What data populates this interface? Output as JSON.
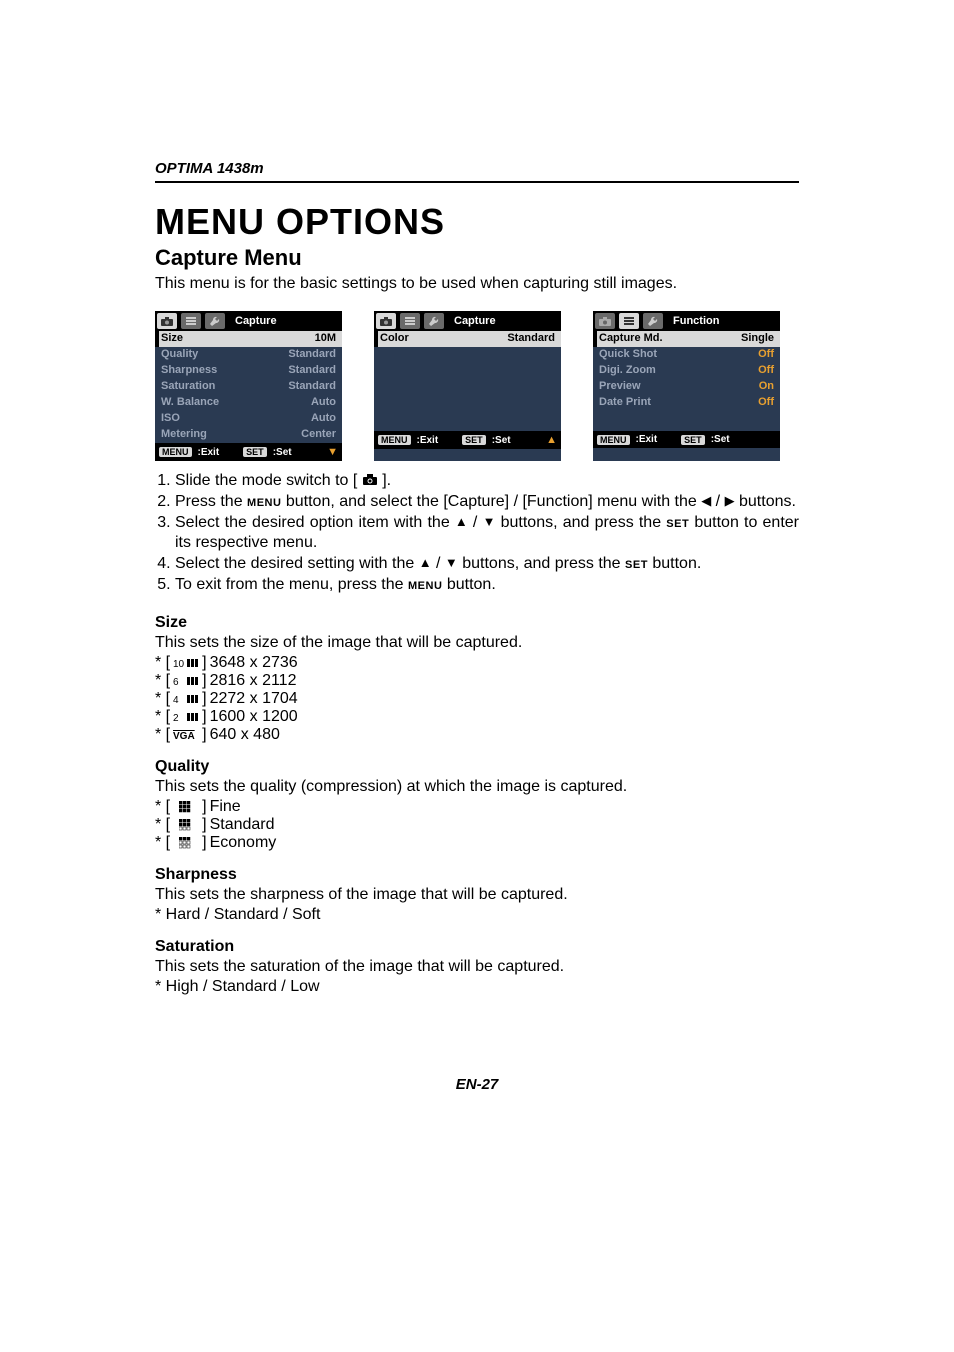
{
  "header": {
    "model": "OPTIMA 1438m"
  },
  "title": "MENU OPTIONS",
  "subtitle": "Capture Menu",
  "intro": "This menu is for the basic settings to be used when capturing still images.",
  "screens": {
    "s1": {
      "tabTitle": "Capture",
      "rows": [
        {
          "label": "Size",
          "value": "10M",
          "sel": true
        },
        {
          "label": "Quality",
          "value": "Standard"
        },
        {
          "label": "Sharpness",
          "value": "Standard"
        },
        {
          "label": "Saturation",
          "value": "Standard"
        },
        {
          "label": "W. Balance",
          "value": "Auto"
        },
        {
          "label": "ISO",
          "value": "Auto"
        },
        {
          "label": "Metering",
          "value": "Center"
        }
      ],
      "arrow": "▼"
    },
    "s2": {
      "tabTitle": "Capture",
      "rows": [
        {
          "label": "Color",
          "value": "Standard",
          "sel": true
        }
      ],
      "arrow": "▲"
    },
    "s3": {
      "tabTitle": "Function",
      "rows": [
        {
          "label": "Capture Md.",
          "value": "Single",
          "sel": true
        },
        {
          "label": "Quick Shot",
          "value": "Off",
          "orange": true
        },
        {
          "label": "Digi. Zoom",
          "value": "Off",
          "orange": true
        },
        {
          "label": "Preview",
          "value": "On",
          "orange": true
        },
        {
          "label": "Date Print",
          "value": "Off",
          "orange": true
        }
      ],
      "arrow": ""
    },
    "bottom": {
      "menuLabel": "MENU",
      "exitLabel": ":Exit",
      "setLabel": "SET",
      "setSuffix": ":Set"
    }
  },
  "steps": [
    "Slide the mode switch to [ 📷 ].",
    "Press the MENU button, and select the [Capture] / [Function] menu with the ◀ / ▶ buttons.",
    "Select the desired option item with the ▲ / ▼ buttons, and press the SET button to enter its respective menu.",
    "Select the desired setting with the ▲ / ▼ buttons, and press the SET button.",
    "To exit from the menu, press the MENU button."
  ],
  "sections": {
    "size": {
      "title": "Size",
      "desc": "This sets the size of the image that will be captured.",
      "opts": [
        {
          "icon": "10m",
          "text": "3648 x 2736"
        },
        {
          "icon": "6m",
          "text": "2816 x 2112"
        },
        {
          "icon": "4m",
          "text": "2272 x 1704"
        },
        {
          "icon": "2m",
          "text": "1600 x 1200"
        },
        {
          "icon": "vga",
          "text": "640 x 480"
        }
      ]
    },
    "quality": {
      "title": "Quality",
      "desc": "This sets the quality (compression) at which the image is captured.",
      "opts": [
        {
          "icon": "q-fine",
          "text": "Fine"
        },
        {
          "icon": "q-std",
          "text": "Standard"
        },
        {
          "icon": "q-eco",
          "text": "Economy"
        }
      ]
    },
    "sharpness": {
      "title": "Sharpness",
      "desc": "This sets the sharpness of the image that will be captured.",
      "line": "* Hard / Standard / Soft"
    },
    "saturation": {
      "title": "Saturation",
      "desc": "This sets the saturation of the image that will be captured.",
      "line": "* High / Standard / Low"
    }
  },
  "footer": "EN-27"
}
